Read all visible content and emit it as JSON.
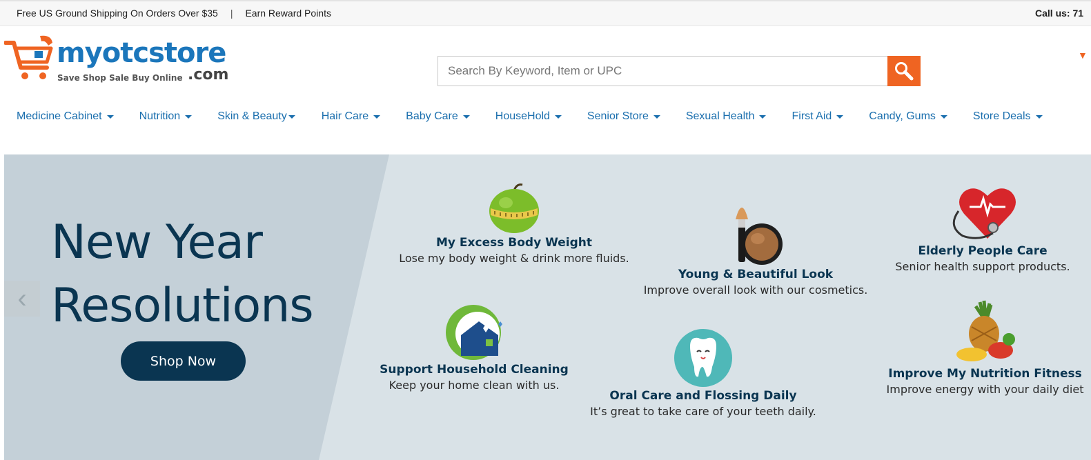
{
  "topbar": {
    "shipping": "Free US Ground Shipping On Orders Over $35",
    "separator": "|",
    "rewards": "Earn Reward Points",
    "call": "Call us: 71"
  },
  "logo": {
    "word": "myotcstore",
    "tagline": "Save Shop Sale Buy Online",
    "domain": ".com"
  },
  "search": {
    "placeholder": "Search By Keyword, Item or UPC",
    "value": ""
  },
  "nav": {
    "items": [
      {
        "label": "Medicine Cabinet"
      },
      {
        "label": "Nutrition"
      },
      {
        "label": "Skin & Beauty"
      },
      {
        "label": "Hair Care"
      },
      {
        "label": "Baby Care"
      },
      {
        "label": "HouseHold"
      },
      {
        "label": "Senior Store"
      },
      {
        "label": "Sexual Health"
      },
      {
        "label": "First Aid"
      },
      {
        "label": "Candy, Gums"
      },
      {
        "label": "Store Deals"
      }
    ]
  },
  "banner": {
    "headline_line1": "New Year",
    "headline_line2": "Resolutions",
    "cta": "Shop Now",
    "prev_arrow": "‹",
    "tiles": [
      {
        "title": "My Excess Body Weight",
        "desc": "Lose my body weight & drink more fluids.",
        "icon": "apple-measuring-tape-icon"
      },
      {
        "title": "Young & Beautiful Look",
        "desc": "Improve overall look with our cosmetics.",
        "icon": "makeup-brush-icon"
      },
      {
        "title": "Elderly People Care",
        "desc": "Senior health support products.",
        "icon": "heart-stethoscope-icon"
      },
      {
        "title": "Support Household Cleaning",
        "desc": "Keep your home clean with us.",
        "icon": "clean-house-icon"
      },
      {
        "title": "Oral Care and Flossing Daily",
        "desc": "It’s great to take care of your teeth daily.",
        "icon": "tooth-icon"
      },
      {
        "title": "Improve My Nutrition Fitness",
        "desc": "Improve energy with your daily diet",
        "icon": "fruits-icon"
      }
    ]
  },
  "colors": {
    "brand_blue": "#1b76bb",
    "brand_orange": "#ef6422",
    "nav_blue": "#1b6fae",
    "banner_bg": "#d9e2e7",
    "banner_dark": "#0a3551"
  }
}
